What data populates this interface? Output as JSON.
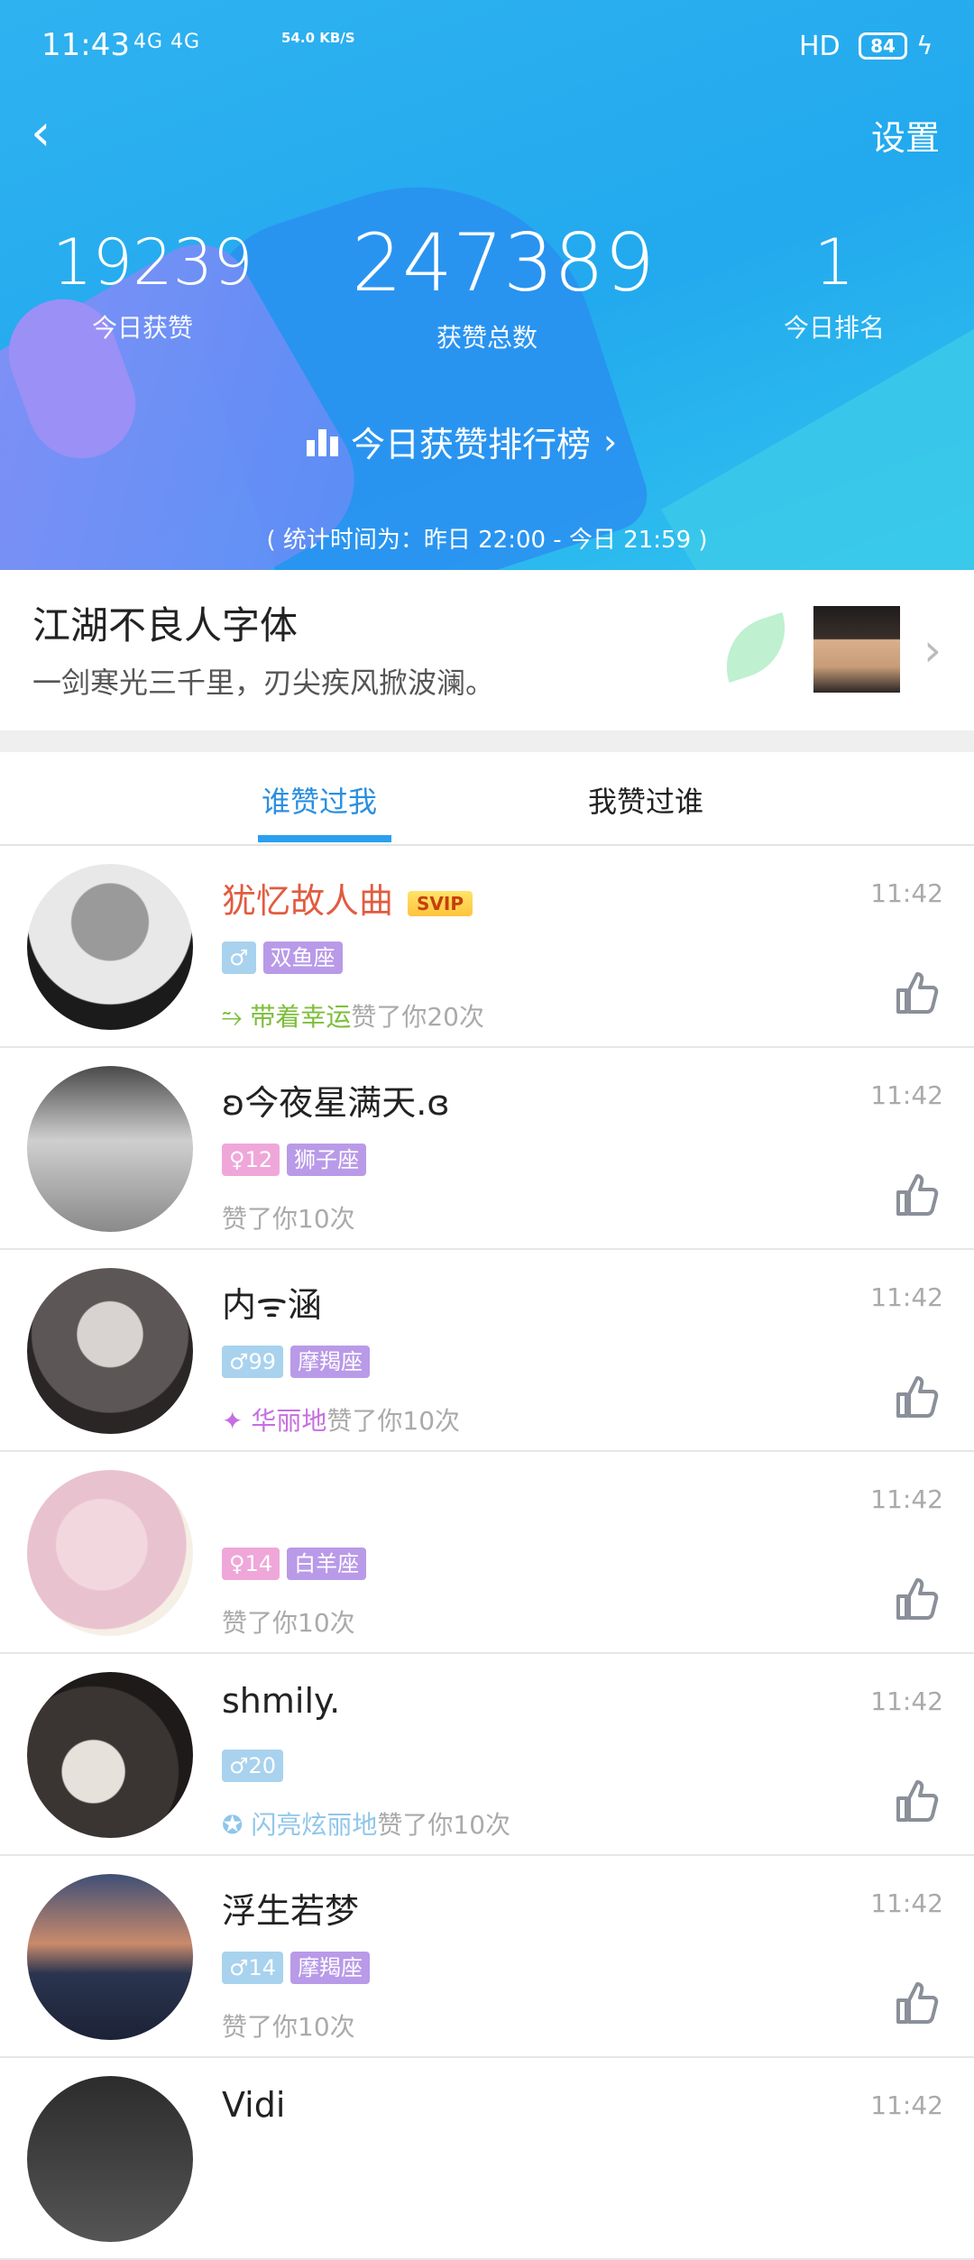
{
  "status": {
    "time": "11:43",
    "network": "4G 4G",
    "speed": "54.0 KB/S",
    "hd": "HD",
    "battery": "84"
  },
  "header": {
    "back_label": "‹",
    "settings_label": "设置",
    "stats": [
      {
        "value": "19239",
        "label": "今日获赞"
      },
      {
        "value": "247389",
        "label": "获赞总数"
      },
      {
        "value": "1",
        "label": "今日排名"
      }
    ],
    "rank_link": "今日获赞排行榜",
    "stat_time": "( 统计时间为：昨日 22:00 - 今日 21:59 )"
  },
  "font_card": {
    "title": "江湖不良人字体",
    "subtitle": "一剑寒光三千里，刃尖疾风掀波澜。"
  },
  "tabs": [
    "谁赞过我",
    "我赞过谁"
  ],
  "list": [
    {
      "name": "犹忆故人曲",
      "svip": "SVIP",
      "gender": "♂",
      "zodiac": "双鱼座",
      "prefix": "带着幸运",
      "likes": "赞了你20次",
      "time": "11:42"
    },
    {
      "name": "ʚ今夜星满天.ɞ",
      "gender": "♀12",
      "zodiac": "狮子座",
      "prefix": "",
      "likes": "赞了你10次",
      "time": "11:42"
    },
    {
      "name": "内ᯤ涵",
      "gender": "♂99",
      "zodiac": "摩羯座",
      "prefix": "华丽地",
      "likes": "赞了你10次",
      "time": "11:42"
    },
    {
      "name": "",
      "gender": "♀14",
      "zodiac": "白羊座",
      "prefix": "",
      "likes": "赞了你10次",
      "time": "11:42"
    },
    {
      "name": "shmily.",
      "gender": "♂20",
      "zodiac": "",
      "prefix": "闪亮炫丽地",
      "likes": "赞了你10次",
      "time": "11:42"
    },
    {
      "name": "浮生若梦",
      "gender": "♂14",
      "zodiac": "摩羯座",
      "prefix": "",
      "likes": "赞了你10次",
      "time": "11:42"
    },
    {
      "name": "Vidi",
      "time": "11:42"
    }
  ]
}
